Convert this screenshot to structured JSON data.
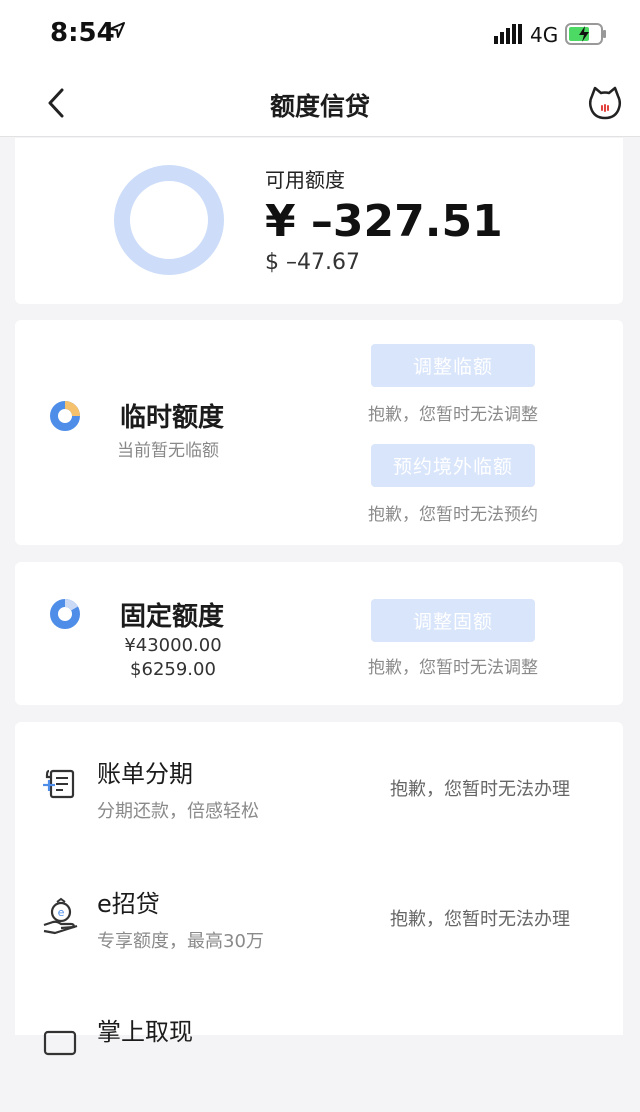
{
  "status_bar": {
    "time": "8:54",
    "network": "4G",
    "location_icon": "location-arrow-icon",
    "signal_icon": "signal-bars-icon",
    "battery_icon": "battery-charging-icon"
  },
  "nav": {
    "title": "额度信贷",
    "back_icon": "chevron-left-icon",
    "mascot_icon": "cat-mascot-icon"
  },
  "summary": {
    "label": "可用额度",
    "cny": "¥ –327.51",
    "usd": "$ –47.67"
  },
  "temp_limit": {
    "title": "临时额度",
    "subtitle": "当前暂无临额",
    "btn1": "调整临额",
    "btn1_note": "抱歉，您暂时无法调整",
    "btn2": "预约境外临额",
    "btn2_note": "抱歉，您暂时无法预约"
  },
  "fixed_limit": {
    "title": "固定额度",
    "cny": "¥43000.00",
    "usd": "$6259.00",
    "btn": "调整固额",
    "btn_note": "抱歉，您暂时无法调整"
  },
  "services": [
    {
      "title": "账单分期",
      "subtitle": "分期还款，倍感轻松",
      "status": "抱歉，您暂时无法办理",
      "icon": "bill-installment-icon"
    },
    {
      "title": "e招贷",
      "subtitle": "专享额度，最高30万",
      "status": "抱歉，您暂时无法办理",
      "icon": "money-bag-hand-icon"
    },
    {
      "title": "掌上取现",
      "subtitle": "",
      "status": "",
      "icon": "cash-withdraw-icon"
    }
  ],
  "colors": {
    "accent_light_blue": "#d9e5fb",
    "ring_blue": "#ccdcf9",
    "pie_blue": "#4f8ee8",
    "pie_orange": "#f5c16c"
  }
}
